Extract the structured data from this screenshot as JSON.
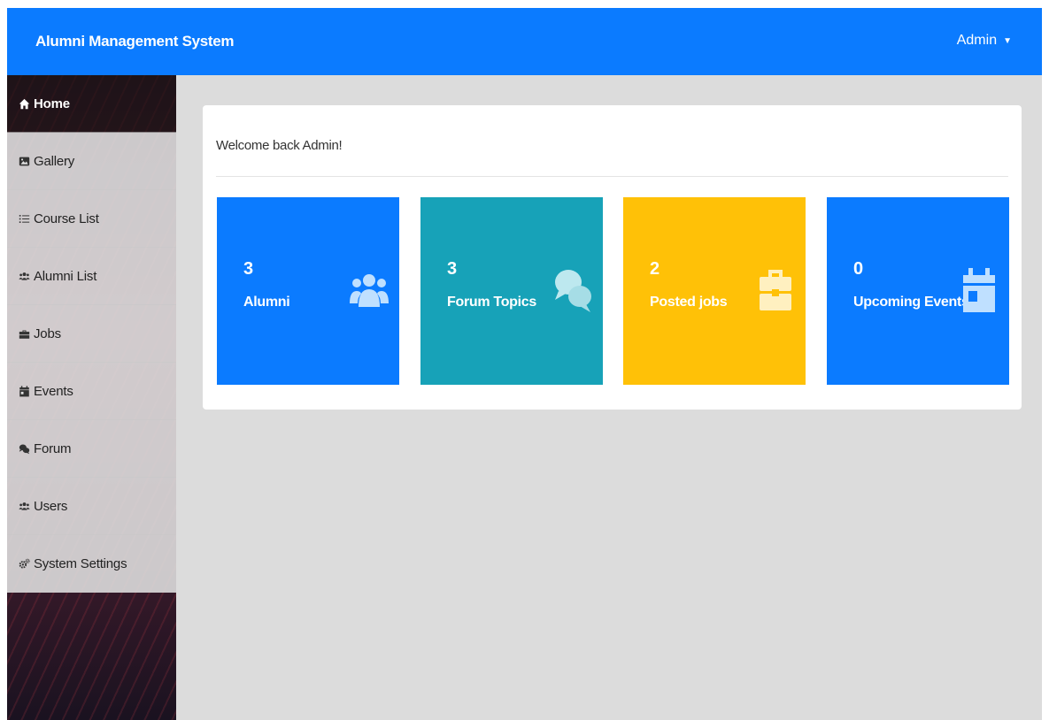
{
  "header": {
    "title": "Alumni Management System",
    "user_label": "Admin",
    "caret": "▼"
  },
  "sidebar": {
    "items": [
      {
        "label": "Home",
        "icon": "home-icon",
        "active": true
      },
      {
        "label": "Gallery",
        "icon": "image-icon"
      },
      {
        "label": "Course List",
        "icon": "list-icon"
      },
      {
        "label": "Alumni List",
        "icon": "users-icon"
      },
      {
        "label": "Jobs",
        "icon": "briefcase-icon"
      },
      {
        "label": "Events",
        "icon": "calendar-icon"
      },
      {
        "label": "Forum",
        "icon": "comments-icon"
      },
      {
        "label": "Users",
        "icon": "users-icon"
      },
      {
        "label": "System Settings",
        "icon": "cogs-icon"
      }
    ]
  },
  "main": {
    "welcome": "Welcome back Admin!",
    "stats": [
      {
        "count": "3",
        "label": "Alumni",
        "icon": "users-icon",
        "color": "#0b7bff"
      },
      {
        "count": "3",
        "label": "Forum Topics",
        "icon": "comments-icon",
        "color": "#17a2b8"
      },
      {
        "count": "2",
        "label": "Posted jobs",
        "icon": "briefcase-icon",
        "color": "#ffc107"
      },
      {
        "count": "0",
        "label": "Upcoming Events",
        "icon": "calendar-icon",
        "color": "#0b7bff"
      }
    ]
  },
  "colors": {
    "topbar": "#0b7bff",
    "page_bg": "#dcdcdc"
  }
}
